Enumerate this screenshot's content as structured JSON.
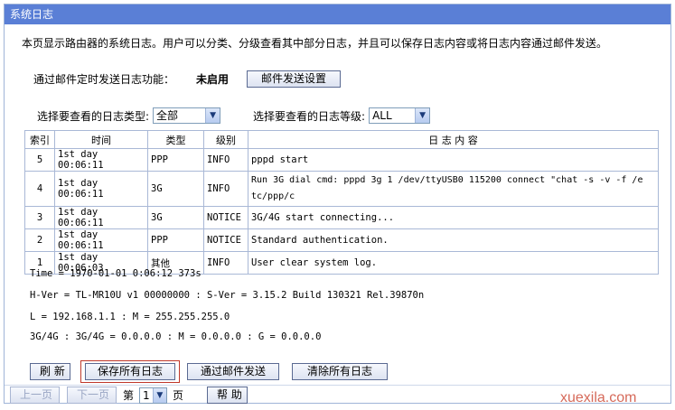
{
  "header": {
    "title": "系统日志"
  },
  "intro": "本页显示路由器的系统日志。用户可以分类、分级查看其中部分日志，并且可以保存日志内容或将日志内容通过邮件发送。",
  "mail": {
    "label": "通过邮件定时发送日志功能：",
    "status": "未启用",
    "settings_button": "邮件发送设置"
  },
  "filters": {
    "type_label": "选择要查看的日志类型:",
    "type_value": "全部",
    "level_label": "选择要查看的日志等级:",
    "level_value": "ALL"
  },
  "table": {
    "headers": [
      "索引",
      "时间",
      "类型",
      "级别",
      "日 志 内 容"
    ],
    "rows": [
      [
        "5",
        "1st day 00:06:11",
        "PPP",
        "INFO",
        "pppd start"
      ],
      [
        "4",
        "1st day 00:06:11",
        "3G",
        "INFO",
        "Run 3G dial cmd: pppd 3g 1 /dev/ttyUSB0 115200 connect \"chat -s -v -f /e",
        "tc/ppp/c"
      ],
      [
        "3",
        "1st day 00:06:11",
        "3G",
        "NOTICE",
        "3G/4G start connecting..."
      ],
      [
        "2",
        "1st day 00:06:11",
        "PPP",
        "NOTICE",
        "Standard authentication."
      ],
      [
        "1",
        "1st day 00:06:03",
        "其他",
        "INFO",
        "User clear system log."
      ]
    ]
  },
  "system": {
    "time": "Time = 1970-01-01 0:06:12 373s",
    "version": "H-Ver = TL-MR10U v1 00000000 : S-Ver = 3.15.2 Build 130321 Rel.39870n",
    "lan": "L = 192.168.1.1 : M = 255.255.255.0",
    "wan": "3G/4G : 3G/4G = 0.0.0.0 : M = 0.0.0.0 : G = 0.0.0.0"
  },
  "actions": {
    "refresh": "刷 新",
    "save_all": "保存所有日志",
    "mail_send": "通过邮件发送",
    "clear_all": "清除所有日志"
  },
  "pager": {
    "prev": "上一页",
    "next": "下一页",
    "page_prefix": "第",
    "page_value": "1",
    "page_suffix": "页",
    "help": "帮 助"
  },
  "watermark": "xuexila.com"
}
